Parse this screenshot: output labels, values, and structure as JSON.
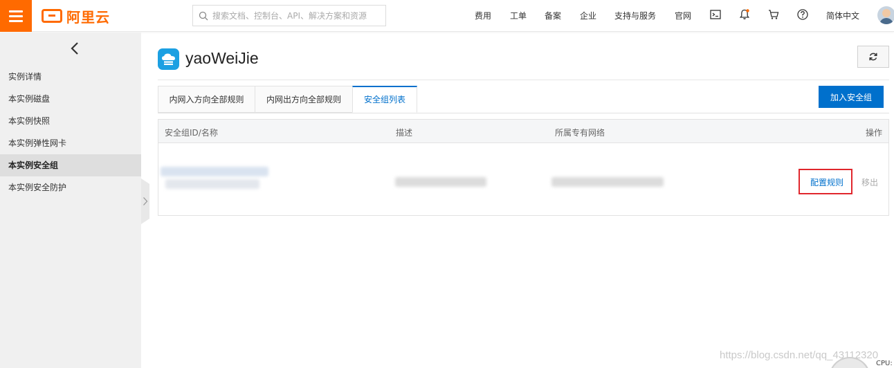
{
  "header": {
    "logo_text": "阿里云",
    "search_placeholder": "搜索文档、控制台、API、解决方案和资源",
    "nav": [
      "费用",
      "工单",
      "备案",
      "企业",
      "支持与服务",
      "官网"
    ],
    "language": "简体中文"
  },
  "sidebar": {
    "items": [
      {
        "label": "实例详情",
        "active": false
      },
      {
        "label": "本实例磁盘",
        "active": false
      },
      {
        "label": "本实例快照",
        "active": false
      },
      {
        "label": "本实例弹性网卡",
        "active": false
      },
      {
        "label": "本实例安全组",
        "active": true
      },
      {
        "label": "本实例安全防护",
        "active": false
      }
    ]
  },
  "main": {
    "title": "yaoWeiJie",
    "tabs": [
      {
        "label": "内网入方向全部规则",
        "active": false
      },
      {
        "label": "内网出方向全部规则",
        "active": false
      },
      {
        "label": "安全组列表",
        "active": true
      }
    ],
    "add_button": "加入安全组",
    "table": {
      "columns": [
        "安全组ID/名称",
        "描述",
        "所属专有网络",
        "操作"
      ],
      "rows": [
        {
          "actions": [
            "配置规则",
            "移出"
          ]
        }
      ]
    }
  },
  "footer": {
    "watermark": "https://blog.csdn.net/qq_43112320",
    "widget_label": "CPU:"
  },
  "colors": {
    "brand": "#ff6a00",
    "primary": "#0070cc",
    "highlight": "#e0262c"
  }
}
